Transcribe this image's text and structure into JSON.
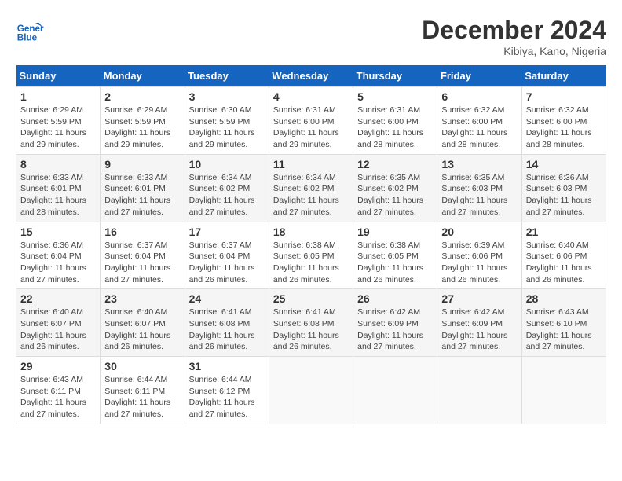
{
  "header": {
    "logo_line1": "General",
    "logo_line2": "Blue",
    "month_title": "December 2024",
    "location": "Kibiya, Kano, Nigeria"
  },
  "weekdays": [
    "Sunday",
    "Monday",
    "Tuesday",
    "Wednesday",
    "Thursday",
    "Friday",
    "Saturday"
  ],
  "weeks": [
    [
      {
        "day": "1",
        "sunrise": "6:29 AM",
        "sunset": "5:59 PM",
        "daylight": "11 hours and 29 minutes."
      },
      {
        "day": "2",
        "sunrise": "6:29 AM",
        "sunset": "5:59 PM",
        "daylight": "11 hours and 29 minutes."
      },
      {
        "day": "3",
        "sunrise": "6:30 AM",
        "sunset": "5:59 PM",
        "daylight": "11 hours and 29 minutes."
      },
      {
        "day": "4",
        "sunrise": "6:31 AM",
        "sunset": "6:00 PM",
        "daylight": "11 hours and 29 minutes."
      },
      {
        "day": "5",
        "sunrise": "6:31 AM",
        "sunset": "6:00 PM",
        "daylight": "11 hours and 28 minutes."
      },
      {
        "day": "6",
        "sunrise": "6:32 AM",
        "sunset": "6:00 PM",
        "daylight": "11 hours and 28 minutes."
      },
      {
        "day": "7",
        "sunrise": "6:32 AM",
        "sunset": "6:00 PM",
        "daylight": "11 hours and 28 minutes."
      }
    ],
    [
      {
        "day": "8",
        "sunrise": "6:33 AM",
        "sunset": "6:01 PM",
        "daylight": "11 hours and 28 minutes."
      },
      {
        "day": "9",
        "sunrise": "6:33 AM",
        "sunset": "6:01 PM",
        "daylight": "11 hours and 27 minutes."
      },
      {
        "day": "10",
        "sunrise": "6:34 AM",
        "sunset": "6:02 PM",
        "daylight": "11 hours and 27 minutes."
      },
      {
        "day": "11",
        "sunrise": "6:34 AM",
        "sunset": "6:02 PM",
        "daylight": "11 hours and 27 minutes."
      },
      {
        "day": "12",
        "sunrise": "6:35 AM",
        "sunset": "6:02 PM",
        "daylight": "11 hours and 27 minutes."
      },
      {
        "day": "13",
        "sunrise": "6:35 AM",
        "sunset": "6:03 PM",
        "daylight": "11 hours and 27 minutes."
      },
      {
        "day": "14",
        "sunrise": "6:36 AM",
        "sunset": "6:03 PM",
        "daylight": "11 hours and 27 minutes."
      }
    ],
    [
      {
        "day": "15",
        "sunrise": "6:36 AM",
        "sunset": "6:04 PM",
        "daylight": "11 hours and 27 minutes."
      },
      {
        "day": "16",
        "sunrise": "6:37 AM",
        "sunset": "6:04 PM",
        "daylight": "11 hours and 27 minutes."
      },
      {
        "day": "17",
        "sunrise": "6:37 AM",
        "sunset": "6:04 PM",
        "daylight": "11 hours and 26 minutes."
      },
      {
        "day": "18",
        "sunrise": "6:38 AM",
        "sunset": "6:05 PM",
        "daylight": "11 hours and 26 minutes."
      },
      {
        "day": "19",
        "sunrise": "6:38 AM",
        "sunset": "6:05 PM",
        "daylight": "11 hours and 26 minutes."
      },
      {
        "day": "20",
        "sunrise": "6:39 AM",
        "sunset": "6:06 PM",
        "daylight": "11 hours and 26 minutes."
      },
      {
        "day": "21",
        "sunrise": "6:40 AM",
        "sunset": "6:06 PM",
        "daylight": "11 hours and 26 minutes."
      }
    ],
    [
      {
        "day": "22",
        "sunrise": "6:40 AM",
        "sunset": "6:07 PM",
        "daylight": "11 hours and 26 minutes."
      },
      {
        "day": "23",
        "sunrise": "6:40 AM",
        "sunset": "6:07 PM",
        "daylight": "11 hours and 26 minutes."
      },
      {
        "day": "24",
        "sunrise": "6:41 AM",
        "sunset": "6:08 PM",
        "daylight": "11 hours and 26 minutes."
      },
      {
        "day": "25",
        "sunrise": "6:41 AM",
        "sunset": "6:08 PM",
        "daylight": "11 hours and 26 minutes."
      },
      {
        "day": "26",
        "sunrise": "6:42 AM",
        "sunset": "6:09 PM",
        "daylight": "11 hours and 27 minutes."
      },
      {
        "day": "27",
        "sunrise": "6:42 AM",
        "sunset": "6:09 PM",
        "daylight": "11 hours and 27 minutes."
      },
      {
        "day": "28",
        "sunrise": "6:43 AM",
        "sunset": "6:10 PM",
        "daylight": "11 hours and 27 minutes."
      }
    ],
    [
      {
        "day": "29",
        "sunrise": "6:43 AM",
        "sunset": "6:11 PM",
        "daylight": "11 hours and 27 minutes."
      },
      {
        "day": "30",
        "sunrise": "6:44 AM",
        "sunset": "6:11 PM",
        "daylight": "11 hours and 27 minutes."
      },
      {
        "day": "31",
        "sunrise": "6:44 AM",
        "sunset": "6:12 PM",
        "daylight": "11 hours and 27 minutes."
      },
      null,
      null,
      null,
      null
    ]
  ]
}
